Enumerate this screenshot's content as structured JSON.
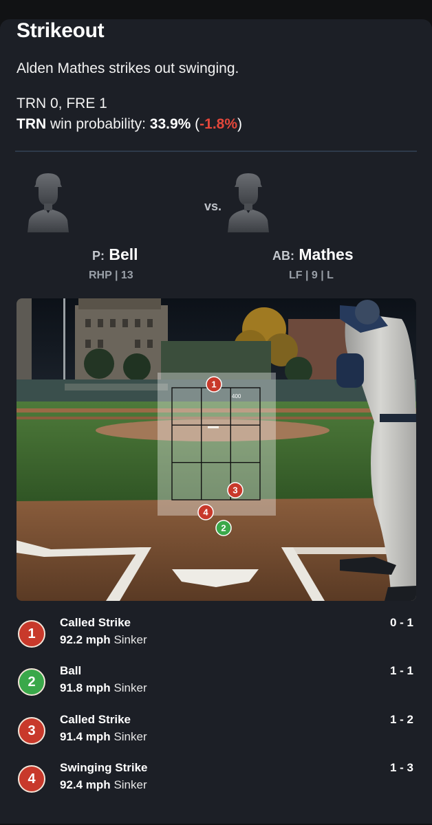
{
  "header": {
    "title": "Strikeout",
    "description": "Alden Mathes strikes out swinging.",
    "score": "TRN 0, FRE 1",
    "win_prob": {
      "team": "TRN",
      "label": "win probability:",
      "value": "33.9%",
      "paren_open": "(",
      "delta": "-1.8%",
      "paren_close": ")"
    }
  },
  "matchup": {
    "vs": "vs.",
    "pitcher": {
      "label": "P:",
      "name": "Bell",
      "info": "RHP | 13"
    },
    "batter": {
      "label": "AB:",
      "name": "Mathes",
      "info": "LF | 9 | L"
    }
  },
  "field": {
    "wall_sign": "400",
    "markers": [
      {
        "num": "1",
        "color": "#c8392b"
      },
      {
        "num": "2",
        "color": "#3aa84a"
      },
      {
        "num": "3",
        "color": "#c8392b"
      },
      {
        "num": "4",
        "color": "#c8392b"
      }
    ]
  },
  "pitches": [
    {
      "num": "1",
      "color": "#c8392b",
      "result": "Called Strike",
      "speed": "92.2 mph",
      "type": "Sinker",
      "count": "0 - 1"
    },
    {
      "num": "2",
      "color": "#3aa84a",
      "result": "Ball",
      "speed": "91.8 mph",
      "type": "Sinker",
      "count": "1 - 1"
    },
    {
      "num": "3",
      "color": "#c8392b",
      "result": "Called Strike",
      "speed": "91.4 mph",
      "type": "Sinker",
      "count": "1 - 2"
    },
    {
      "num": "4",
      "color": "#c8392b",
      "result": "Swinging Strike",
      "speed": "92.4 mph",
      "type": "Sinker",
      "count": "1 - 3"
    }
  ],
  "icons": [
    "player-silhouette-icon"
  ]
}
